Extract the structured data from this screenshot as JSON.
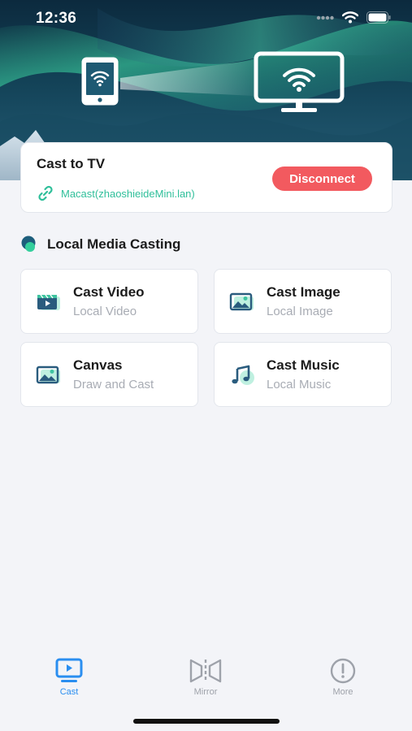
{
  "status_bar": {
    "time": "12:36"
  },
  "cast_card": {
    "title": "Cast to TV",
    "device_name": "Macast(zhaoshieideMini.lan)",
    "disconnect_label": "Disconnect"
  },
  "section": {
    "title": "Local Media Casting"
  },
  "features": [
    {
      "title": "Cast Video",
      "subtitle": "Local Video",
      "icon": "video-clapper-icon"
    },
    {
      "title": "Cast Image",
      "subtitle": "Local Image",
      "icon": "image-icon"
    },
    {
      "title": "Canvas",
      "subtitle": "Draw and Cast",
      "icon": "canvas-image-icon"
    },
    {
      "title": "Cast Music",
      "subtitle": "Local Music",
      "icon": "music-note-icon"
    }
  ],
  "tabs": [
    {
      "label": "Cast",
      "icon": "tv-play-icon",
      "active": true
    },
    {
      "label": "Mirror",
      "icon": "mirror-icon",
      "active": false
    },
    {
      "label": "More",
      "icon": "exclamation-circle-icon",
      "active": false
    }
  ],
  "colors": {
    "accent": "#2a8ef0",
    "success": "#2fbf9a",
    "danger": "#f25a5f",
    "background": "#f3f4f8"
  }
}
